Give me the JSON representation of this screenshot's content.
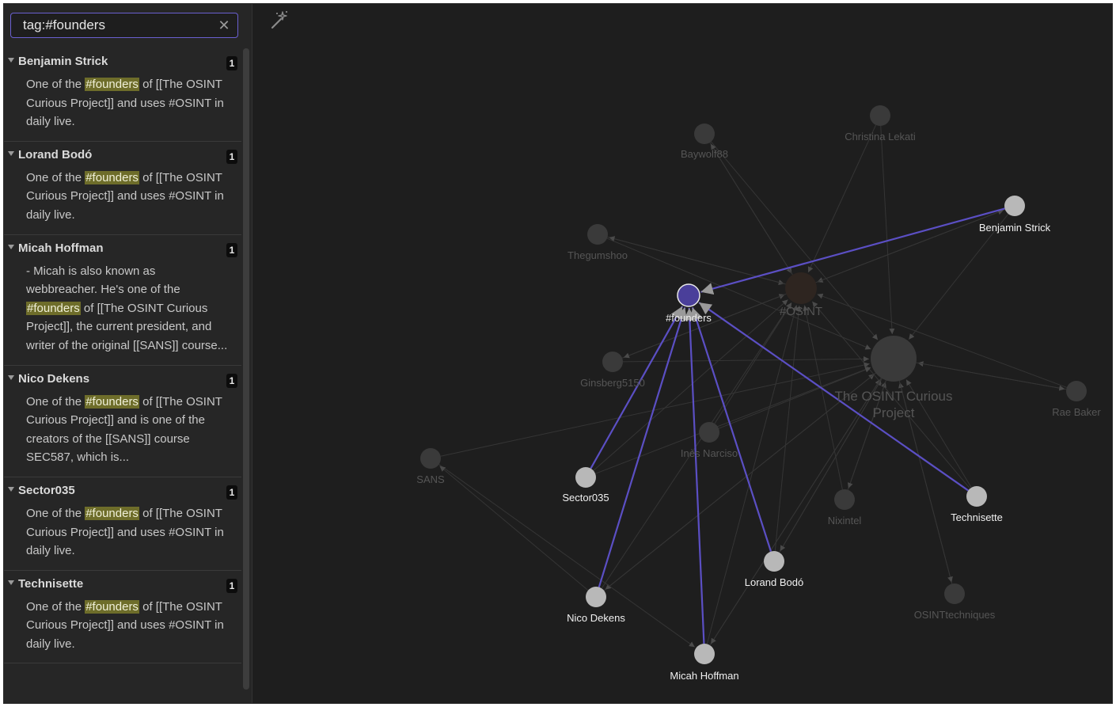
{
  "search": {
    "query": "tag:#founders",
    "clear_icon": "close-icon"
  },
  "results": [
    {
      "title": "Benjamin Strick",
      "count": "1",
      "snippet": [
        {
          "t": "One of the "
        },
        {
          "t": "#founders",
          "hl": true
        },
        {
          "t": " of [[The OSINT Curious Project]] and uses #OSINT in daily live."
        }
      ]
    },
    {
      "title": "Lorand Bodó",
      "count": "1",
      "snippet": [
        {
          "t": "One of the "
        },
        {
          "t": "#founders",
          "hl": true
        },
        {
          "t": " of [[The OSINT Curious Project]] and uses #OSINT in daily live."
        }
      ]
    },
    {
      "title": "Micah Hoffman",
      "count": "1",
      "snippet": [
        {
          "t": "- Micah is also known as webbreacher. He's one of the "
        },
        {
          "t": "#founders",
          "hl": true
        },
        {
          "t": " of [[The OSINT Curious Project]], the current president, and writer of the original [[SANS]] course..."
        }
      ]
    },
    {
      "title": "Nico Dekens",
      "count": "1",
      "snippet": [
        {
          "t": "One of the "
        },
        {
          "t": "#founders",
          "hl": true
        },
        {
          "t": " of [[The OSINT Curious Project]] and is one of the creators of the [[SANS]] course SEC587, which is..."
        }
      ]
    },
    {
      "title": "Sector035",
      "count": "1",
      "snippet": [
        {
          "t": "One of the "
        },
        {
          "t": "#founders",
          "hl": true
        },
        {
          "t": " of [[The OSINT Curious Project]] and uses #OSINT in daily live."
        }
      ]
    },
    {
      "title": "Technisette",
      "count": "1",
      "snippet": [
        {
          "t": "One of the "
        },
        {
          "t": "#founders",
          "hl": true
        },
        {
          "t": " of [[The OSINT Curious Project]] and uses #OSINT in daily live."
        }
      ]
    }
  ],
  "toolbar": {
    "wand_icon": "magic-wand-icon"
  },
  "graph": {
    "colors": {
      "highlight_node": "#4a3f9a",
      "highlight_edge": "#5b4fc4",
      "active_node": "#b8b8b8",
      "dim_node": "#3a3a3a",
      "dim_edge": "#353535",
      "dim_label": "#555555",
      "active_label": "#f0f0f0",
      "osint_node": "#2e2520"
    },
    "nodes": [
      {
        "id": "founders",
        "label": "#founders",
        "state": "highlight"
      },
      {
        "id": "osint",
        "label": "#OSINT",
        "state": "dim"
      },
      {
        "id": "ocp",
        "label": "The OSINT Curious Project",
        "state": "dim"
      },
      {
        "id": "benjamin",
        "label": "Benjamin Strick",
        "state": "active"
      },
      {
        "id": "sector",
        "label": "Sector035",
        "state": "active"
      },
      {
        "id": "nico",
        "label": "Nico Dekens",
        "state": "active"
      },
      {
        "id": "micah",
        "label": "Micah Hoffman",
        "state": "active"
      },
      {
        "id": "lorand",
        "label": "Lorand Bodó",
        "state": "active"
      },
      {
        "id": "technisette",
        "label": "Technisette",
        "state": "active"
      },
      {
        "id": "baywolf",
        "label": "Baywolf88",
        "state": "dim"
      },
      {
        "id": "christina",
        "label": "Christina Lekati",
        "state": "dim"
      },
      {
        "id": "thegumshoo",
        "label": "Thegumshoo",
        "state": "dim"
      },
      {
        "id": "ginsberg",
        "label": "Ginsberg5150",
        "state": "dim"
      },
      {
        "id": "ines",
        "label": "Inès Narciso",
        "state": "dim"
      },
      {
        "id": "sans",
        "label": "SANS",
        "state": "dim"
      },
      {
        "id": "nixintel",
        "label": "Nixintel",
        "state": "dim"
      },
      {
        "id": "osinttech",
        "label": "OSINTtechniques",
        "state": "dim"
      },
      {
        "id": "rae",
        "label": "Rae Baker",
        "state": "dim"
      }
    ],
    "edges": [
      {
        "from": "benjamin",
        "to": "founders",
        "state": "highlight"
      },
      {
        "from": "sector",
        "to": "founders",
        "state": "highlight"
      },
      {
        "from": "nico",
        "to": "founders",
        "state": "highlight"
      },
      {
        "from": "micah",
        "to": "founders",
        "state": "highlight"
      },
      {
        "from": "lorand",
        "to": "founders",
        "state": "highlight"
      },
      {
        "from": "technisette",
        "to": "founders",
        "state": "highlight"
      },
      {
        "from": "baywolf",
        "to": "osint",
        "state": "dim"
      },
      {
        "from": "christina",
        "to": "osint",
        "state": "dim"
      },
      {
        "from": "thegumshoo",
        "to": "osint",
        "state": "dim"
      },
      {
        "from": "ginsberg",
        "to": "osint",
        "state": "dim"
      },
      {
        "from": "ines",
        "to": "osint",
        "state": "dim"
      },
      {
        "from": "sector",
        "to": "osint",
        "state": "dim"
      },
      {
        "from": "nico",
        "to": "osint",
        "state": "dim"
      },
      {
        "from": "micah",
        "to": "osint",
        "state": "dim"
      },
      {
        "from": "lorand",
        "to": "osint",
        "state": "dim"
      },
      {
        "from": "technisette",
        "to": "osint",
        "state": "dim"
      },
      {
        "from": "benjamin",
        "to": "osint",
        "state": "dim"
      },
      {
        "from": "nixintel",
        "to": "osint",
        "state": "dim"
      },
      {
        "from": "rae",
        "to": "osint",
        "state": "dim"
      },
      {
        "from": "christina",
        "to": "ocp",
        "state": "dim"
      },
      {
        "from": "benjamin",
        "to": "ocp",
        "state": "dim"
      },
      {
        "from": "baywolf",
        "to": "ocp",
        "state": "dim"
      },
      {
        "from": "thegumshoo",
        "to": "ocp",
        "state": "dim"
      },
      {
        "from": "ginsberg",
        "to": "ocp",
        "state": "dim"
      },
      {
        "from": "ines",
        "to": "ocp",
        "state": "dim"
      },
      {
        "from": "sector",
        "to": "ocp",
        "state": "dim"
      },
      {
        "from": "nico",
        "to": "ocp",
        "state": "dim"
      },
      {
        "from": "micah",
        "to": "ocp",
        "state": "dim"
      },
      {
        "from": "lorand",
        "to": "ocp",
        "state": "dim"
      },
      {
        "from": "technisette",
        "to": "ocp",
        "state": "dim"
      },
      {
        "from": "rae",
        "to": "ocp",
        "state": "dim"
      },
      {
        "from": "osinttech",
        "to": "ocp",
        "state": "dim"
      },
      {
        "from": "nixintel",
        "to": "ocp",
        "state": "dim"
      },
      {
        "from": "osint",
        "to": "thegumshoo",
        "state": "dim"
      },
      {
        "from": "osint",
        "to": "ginsberg",
        "state": "dim"
      },
      {
        "from": "osint",
        "to": "baywolf",
        "state": "dim"
      },
      {
        "from": "ocp",
        "to": "nixintel",
        "state": "dim"
      },
      {
        "from": "ocp",
        "to": "osinttech",
        "state": "dim"
      },
      {
        "from": "ocp",
        "to": "rae",
        "state": "dim"
      },
      {
        "from": "ocp",
        "to": "micah",
        "state": "dim"
      },
      {
        "from": "ocp",
        "to": "lorand",
        "state": "dim"
      },
      {
        "from": "ocp",
        "to": "nico",
        "state": "dim"
      },
      {
        "from": "sans",
        "to": "micah",
        "state": "dim"
      },
      {
        "from": "nico",
        "to": "sans",
        "state": "dim"
      },
      {
        "from": "sans",
        "to": "ocp",
        "state": "dim"
      },
      {
        "from": "osint",
        "to": "benjamin",
        "state": "dim"
      }
    ]
  }
}
